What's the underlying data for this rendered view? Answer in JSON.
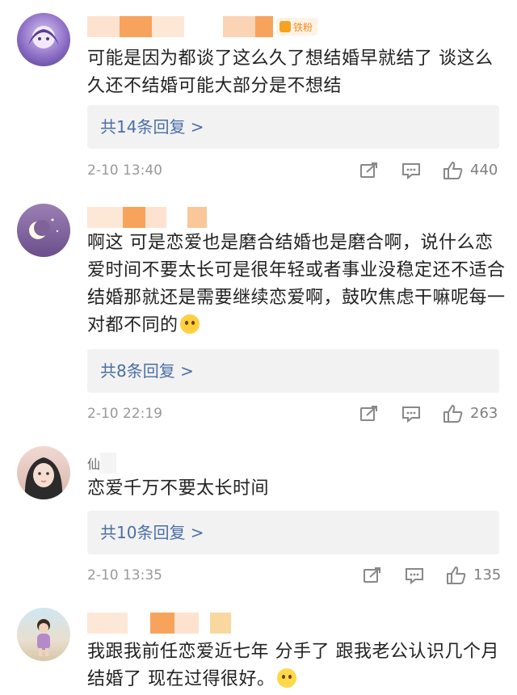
{
  "comments": [
    {
      "avatar_icon": "anime-girl-avatar",
      "badge": "铁粉",
      "text": "可能是因为都谈了这么久了想结婚早就结了 谈这么久还不结婚可能大部分是不想结",
      "replies": "共14条回复 >",
      "time": "2-10 13:40",
      "likes": "440"
    },
    {
      "avatar_icon": "moon-night-avatar",
      "text": "啊这 可是恋爱也是磨合结婚也是磨合啊，说什么恋爱时间不要太长可是很年轻或者事业没稳定还不适合结婚那就还是需要继续恋爱啊，鼓吹焦虑干嘛呢每一对都不同的",
      "emoji_icon": "crying-face-emoji",
      "replies": "共8条回复 >",
      "time": "2-10 22:19",
      "likes": "263"
    },
    {
      "avatar_icon": "girl-photo-avatar",
      "name_fragment": "仙",
      "text": "恋爱千万不要太长时间",
      "replies": "共10条回复 >",
      "time": "2-10 13:35",
      "likes": "135"
    },
    {
      "avatar_icon": "child-beach-avatar",
      "text": "我跟我前任恋爱近七年 分手了 跟我老公认识几个月结婚了 现在过得很好。",
      "emoji_icon": "happy-face-emoji"
    }
  ],
  "icons": {
    "repost": "repost-icon",
    "comment": "comment-icon",
    "like": "thumbs-up-icon"
  },
  "colors": {
    "reply_link": "#4a6fa5",
    "reply_bg": "#f2f2f2",
    "meta_text": "#999999",
    "censor_orange": "#f7a35c",
    "badge_orange": "#f08c1a"
  }
}
